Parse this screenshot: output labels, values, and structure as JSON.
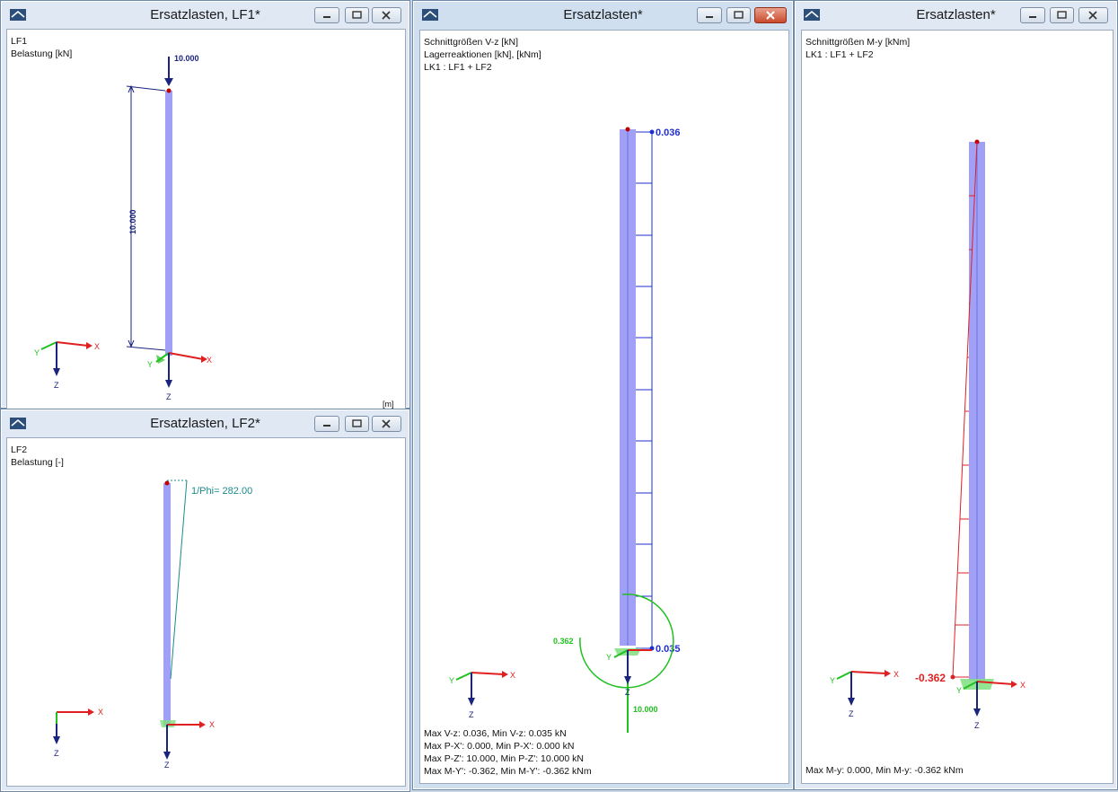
{
  "windows": {
    "lf1": {
      "title": "Ersatzlasten, LF1*",
      "info": [
        "LF1",
        "Belastung [kN]"
      ],
      "load_value": "10.000",
      "dimension": "10.000",
      "unit_corner": "[m]"
    },
    "lf2": {
      "title": "Ersatzlasten, LF2*",
      "info": [
        "LF2",
        "Belastung [-]"
      ],
      "imperfection": "1/Phi= 282.00"
    },
    "vz": {
      "title": "Ersatzlasten*",
      "info": [
        "Schnittgrößen V-z [kN]",
        "Lagerreaktionen [kN], [kNm]",
        "LK1 : LF1 + LF2"
      ],
      "top_value": "0.036",
      "bottom_value": "0.035",
      "moment_reaction": "0.362",
      "vertical_reaction": "10.000",
      "summary": [
        "Max V-z: 0.036, Min V-z: 0.035 kN",
        "Max P-X': 0.000, Min P-X': 0.000 kN",
        "Max P-Z': 10.000, Min P-Z': 10.000 kN",
        "Max M-Y': -0.362, Min M-Y': -0.362 kNm"
      ]
    },
    "my": {
      "title": "Ersatzlasten*",
      "info": [
        "Schnittgrößen M-y [kNm]",
        "LK1 : LF1 + LF2"
      ],
      "bottom_value": "-0.362",
      "summary": [
        "Max M-y: 0.000, Min M-y: -0.362 kNm"
      ]
    }
  },
  "axes": {
    "x": "X",
    "y": "Y",
    "z": "Z"
  },
  "colors": {
    "column": "#8f8ff5",
    "load": "#1a237e",
    "shear": "#1f2ed1",
    "moment": "#e02020",
    "reaction": "#20c020",
    "imperfection": "#1a8a8a"
  }
}
